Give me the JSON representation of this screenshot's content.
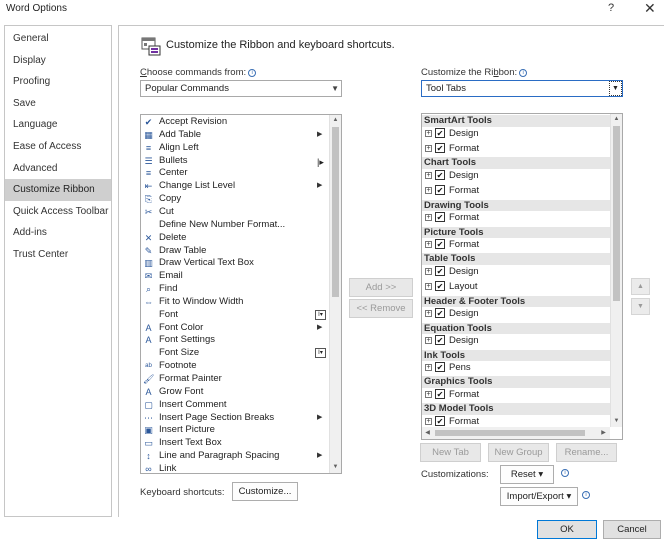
{
  "window": {
    "title": "Word Options",
    "help": "?",
    "close": "✕"
  },
  "sidebar": {
    "items": [
      {
        "label": "General"
      },
      {
        "label": "Display"
      },
      {
        "label": "Proofing"
      },
      {
        "label": "Save"
      },
      {
        "label": "Language"
      },
      {
        "label": "Ease of Access"
      },
      {
        "label": "Advanced"
      },
      {
        "label": "Customize Ribbon"
      },
      {
        "label": "Quick Access Toolbar"
      },
      {
        "label": "Add-ins"
      },
      {
        "label": "Trust Center"
      }
    ],
    "selected": "Customize Ribbon"
  },
  "header": {
    "text": "Customize the Ribbon and keyboard shortcuts."
  },
  "left": {
    "label_prefix": "C",
    "label_rest": "hoose commands from:",
    "combo_value": "Popular Commands",
    "commands": [
      {
        "label": "Accept Revision",
        "icon": "✔"
      },
      {
        "label": "Add Table",
        "icon": "▦",
        "submenu": "▶"
      },
      {
        "label": "Align Left",
        "icon": "≡"
      },
      {
        "label": "Bullets",
        "icon": "☰",
        "bar": "|▸"
      },
      {
        "label": "Center",
        "icon": "≡"
      },
      {
        "label": "Change List Level",
        "icon": "⇤",
        "submenu": "▶"
      },
      {
        "label": "Copy",
        "icon": "⎘"
      },
      {
        "label": "Cut",
        "icon": "✂"
      },
      {
        "label": "Define New Number Format...",
        "icon": ""
      },
      {
        "label": "Delete",
        "icon": "✕"
      },
      {
        "label": "Draw Table",
        "icon": "✎"
      },
      {
        "label": "Draw Vertical Text Box",
        "icon": "▥"
      },
      {
        "label": "Email",
        "icon": "✉"
      },
      {
        "label": "Find",
        "icon": "⌕"
      },
      {
        "label": "Fit to Window Width",
        "icon": "⇔"
      },
      {
        "label": "Font",
        "icon": "",
        "fbox": "I▾"
      },
      {
        "label": "Font Color",
        "icon": "A",
        "submenu": "▶"
      },
      {
        "label": "Font Settings",
        "icon": "A"
      },
      {
        "label": "Font Size",
        "icon": "",
        "fbox": "I▾"
      },
      {
        "label": "Footnote",
        "icon": "ᵃᵇ"
      },
      {
        "label": "Format Painter",
        "icon": "🖌"
      },
      {
        "label": "Grow Font",
        "icon": "A"
      },
      {
        "label": "Insert Comment",
        "icon": "▢"
      },
      {
        "label": "Insert Page  Section Breaks",
        "icon": "⋯",
        "submenu": "▶"
      },
      {
        "label": "Insert Picture",
        "icon": "▣"
      },
      {
        "label": "Insert Text Box",
        "icon": "▭"
      },
      {
        "label": "Line and Paragraph Spacing",
        "icon": "↕",
        "submenu": "▶"
      },
      {
        "label": "Link",
        "icon": "∞"
      }
    ]
  },
  "right": {
    "label_prefix": "Customize the Ri",
    "label_underline": "b",
    "label_rest": "bon:",
    "combo_value": "Tool Tabs",
    "tree": [
      {
        "type": "group",
        "label": "SmartArt Tools"
      },
      {
        "type": "tab",
        "label": "Design",
        "checked": "✔"
      },
      {
        "type": "tab",
        "label": "Format",
        "checked": "✔"
      },
      {
        "type": "group",
        "label": "Chart Tools"
      },
      {
        "type": "tab",
        "label": "Design",
        "checked": "✔"
      },
      {
        "type": "tab",
        "label": "Format",
        "checked": "✔"
      },
      {
        "type": "group",
        "label": "Drawing Tools"
      },
      {
        "type": "tab",
        "label": "Format",
        "checked": "✔"
      },
      {
        "type": "group",
        "label": "Picture Tools"
      },
      {
        "type": "tab",
        "label": "Format",
        "checked": "✔"
      },
      {
        "type": "group",
        "label": "Table Tools"
      },
      {
        "type": "tab",
        "label": "Design",
        "checked": "✔"
      },
      {
        "type": "tab",
        "label": "Layout",
        "checked": "✔"
      },
      {
        "type": "group",
        "label": "Header & Footer Tools"
      },
      {
        "type": "tab",
        "label": "Design",
        "checked": "✔"
      },
      {
        "type": "group",
        "label": "Equation Tools"
      },
      {
        "type": "tab",
        "label": "Design",
        "checked": "✔"
      },
      {
        "type": "group",
        "label": "Ink Tools"
      },
      {
        "type": "tab",
        "label": "Pens",
        "checked": "✔"
      },
      {
        "type": "group",
        "label": "Graphics Tools"
      },
      {
        "type": "tab",
        "label": "Format",
        "checked": "✔"
      },
      {
        "type": "group",
        "label": "3D Model Tools"
      },
      {
        "type": "tab",
        "label": "Format",
        "checked": "✔"
      }
    ]
  },
  "buttons": {
    "add": "Add >>",
    "remove": "<< Remove",
    "new_tab": "New Tab",
    "new_group": "New Group",
    "rename": "Rename...",
    "reset": "Reset ▾",
    "import_export": "Import/Export ▾",
    "customize": "Customize...",
    "ok": "OK",
    "cancel": "Cancel",
    "move_up": "▲",
    "move_down": "▼"
  },
  "labels": {
    "keyboard_shortcuts": "Keyboard shortcuts:",
    "customizations": "Customizations:"
  }
}
